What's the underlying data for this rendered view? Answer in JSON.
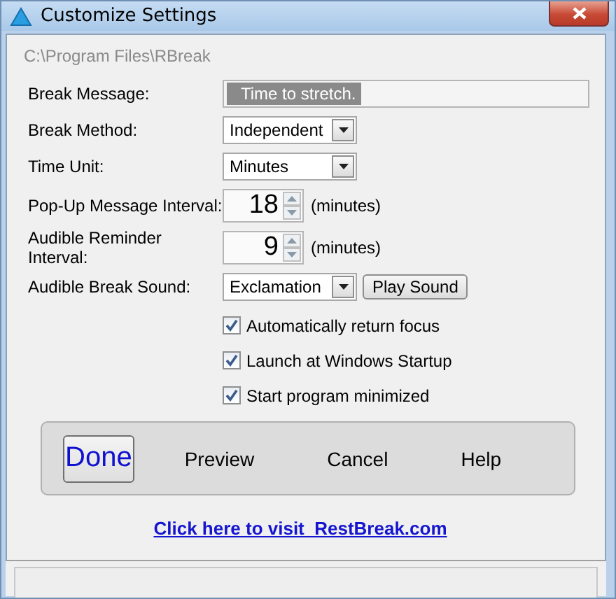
{
  "window": {
    "title": "Customize Settings"
  },
  "path": "C:\\Program Files\\RBreak",
  "fields": [
    {
      "kind": "text",
      "label": "Break Message:",
      "value": "Time to stretch.",
      "selected": true
    },
    {
      "kind": "dropdown",
      "label": "Break Method:",
      "value": "Independent"
    },
    {
      "kind": "dropdown",
      "label": "Time Unit:",
      "value": "Minutes"
    },
    {
      "kind": "spinner",
      "label": "Pop-Up Message Interval:",
      "value": "18",
      "unit": "(minutes)"
    },
    {
      "kind": "spinner",
      "label": "Audible Reminder Interval:",
      "value": "9",
      "unit": "(minutes)"
    },
    {
      "kind": "dropdown",
      "label": "Audible Break Sound:",
      "value": "Exclamation",
      "button": "Play Sound"
    }
  ],
  "checkboxes": [
    {
      "label": "Automatically return focus",
      "checked": true
    },
    {
      "label": "Launch at Windows Startup",
      "checked": true
    },
    {
      "label": "Start program minimized",
      "checked": true
    }
  ],
  "buttons": [
    {
      "label": "Done",
      "kind": "default"
    },
    {
      "label": "Preview",
      "kind": "flat"
    },
    {
      "label": "Cancel",
      "kind": "flat"
    },
    {
      "label": "Help",
      "kind": "flat"
    }
  ],
  "link": "Click here to visit  RestBreak.com"
}
